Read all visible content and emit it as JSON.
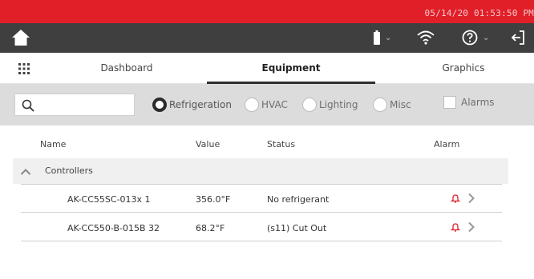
{
  "statusbar": {
    "datetime": "05/14/20 01:53:50 PM"
  },
  "toolbar": {
    "home_icon": "home-icon",
    "battery_icon": "battery-icon",
    "wifi_icon": "wifi-icon",
    "help_icon": "help-icon",
    "logout_icon": "logout-icon"
  },
  "tabs": [
    {
      "label": "Dashboard",
      "active": false
    },
    {
      "label": "Equipment",
      "active": true
    },
    {
      "label": "Graphics",
      "active": false
    }
  ],
  "filters": {
    "search": {
      "value": "",
      "placeholder": ""
    },
    "options": [
      {
        "label": "Refrigeration",
        "selected": true
      },
      {
        "label": "HVAC",
        "selected": false
      },
      {
        "label": "Lighting",
        "selected": false
      },
      {
        "label": "Misc",
        "selected": false
      }
    ],
    "alarms": {
      "label": "Alarms",
      "checked": false
    }
  },
  "table": {
    "columns": [
      "Name",
      "Value",
      "Status",
      "Alarm"
    ],
    "group": {
      "label": "Controllers",
      "expanded": true
    },
    "rows": [
      {
        "name": "AK-CC55SC-013x 1",
        "value": "356.0°F",
        "status": "No refrigerant"
      },
      {
        "name": "AK-CC550-B-015B 32",
        "value": "68.2°F",
        "status": "(s11) Cut Out"
      }
    ]
  },
  "colors": {
    "topbar": "#e01f28",
    "toolbar": "#3f3f3f",
    "alarm": "#e01f28"
  }
}
